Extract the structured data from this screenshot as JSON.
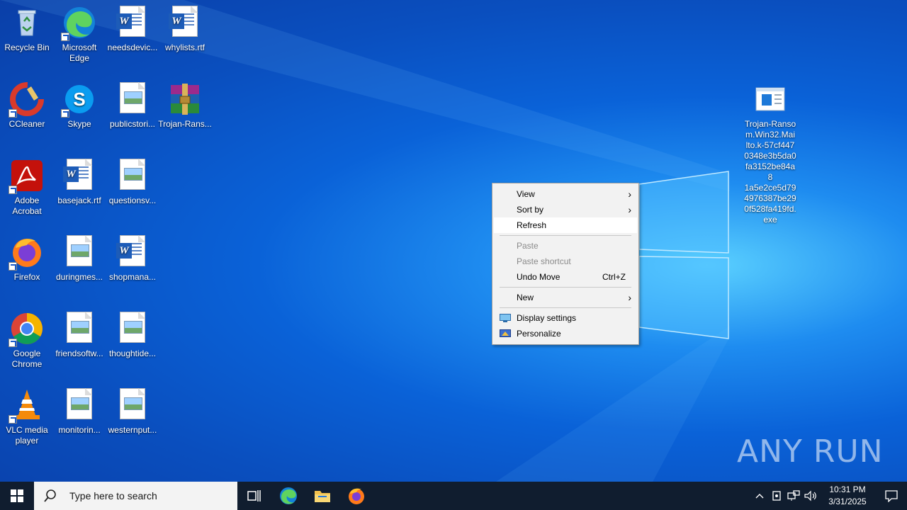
{
  "desktop": {
    "icons": [
      {
        "label": "Recycle Bin"
      },
      {
        "label": "Microsoft Edge"
      },
      {
        "label": "needsdevic..."
      },
      {
        "label": "whylists.rtf"
      },
      {
        "label": "CCleaner"
      },
      {
        "label": "Skype"
      },
      {
        "label": "publicstori..."
      },
      {
        "label": "Trojan-Rans..."
      },
      {
        "label": "Adobe Acrobat"
      },
      {
        "label": "basejack.rtf"
      },
      {
        "label": "questionsv..."
      },
      {
        "label": "Firefox"
      },
      {
        "label": "duringmes..."
      },
      {
        "label": "shopmana..."
      },
      {
        "label": "Google Chrome"
      },
      {
        "label": "friendsoftw..."
      },
      {
        "label": "thoughtide..."
      },
      {
        "label": "VLC media player"
      },
      {
        "label": "monitorin..."
      },
      {
        "label": "westernput..."
      },
      {
        "label": "Trojan-Ranso m.Win32.Mai lto.k-57cf447 0348e3b5da0 fa3152be84a8 1a5e2ce5d79 4976387be29 0f528fa419fd. exe"
      }
    ]
  },
  "context_menu": {
    "items": [
      {
        "label": "View",
        "submenu": true
      },
      {
        "label": "Sort by",
        "submenu": true
      },
      {
        "label": "Refresh"
      },
      {
        "label": "Paste"
      },
      {
        "label": "Paste shortcut"
      },
      {
        "label": "Undo Move",
        "shortcut": "Ctrl+Z"
      },
      {
        "label": "New",
        "submenu": true
      },
      {
        "label": "Display settings"
      },
      {
        "label": "Personalize"
      }
    ],
    "highlighted": "Refresh"
  },
  "taskbar": {
    "search_placeholder": "Type here to search",
    "clock_time": "10:31 PM",
    "clock_date": "3/31/2025"
  },
  "watermark": {
    "text": "ANY RUN"
  }
}
